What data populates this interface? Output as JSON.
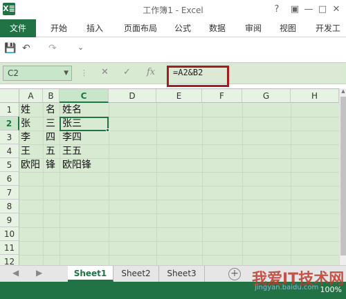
{
  "window": {
    "title": "工作簿1 - Excel",
    "app_logo": "X≣"
  },
  "window_buttons": {
    "help": "?",
    "ribbon_options": "▣",
    "minimize": "—",
    "maximize": "□",
    "close": "✕"
  },
  "ribbon": {
    "tabs": [
      "文件",
      "开始",
      "插入",
      "页面布局",
      "公式",
      "数据",
      "审阅",
      "视图",
      "开发工"
    ]
  },
  "quick_access": {
    "save_icon": "💾",
    "undo": "↶",
    "redo": "↷",
    "customize": "⌄"
  },
  "formula_bar": {
    "name_box": "C2",
    "name_box_arrow": "▼",
    "cancel": "✕",
    "enter": "✓",
    "fx": "fx",
    "formula": "=A2&B2"
  },
  "grid": {
    "columns": [
      "A",
      "B",
      "C",
      "D",
      "E",
      "F",
      "G",
      "H"
    ],
    "rows": [
      "1",
      "2",
      "3",
      "4",
      "5",
      "6",
      "7",
      "8",
      "9",
      "10",
      "11",
      "12"
    ],
    "data": [
      [
        "姓",
        "名",
        "姓名"
      ],
      [
        "张",
        "三",
        "张三"
      ],
      [
        "李",
        "四",
        "李四"
      ],
      [
        "王",
        "五",
        "王五"
      ],
      [
        "欧阳",
        "锋",
        "欧阳锋"
      ]
    ],
    "active_cell": "C2",
    "active_column": "C",
    "active_row": "2"
  },
  "sheets": {
    "tabs": [
      "Sheet1",
      "Sheet2",
      "Sheet3"
    ],
    "active": "Sheet1",
    "add": "+"
  },
  "status": {
    "zoom": "100%"
  },
  "watermark": {
    "text": "我爱IT技术网",
    "url": "jingyan.baidu.com"
  }
}
